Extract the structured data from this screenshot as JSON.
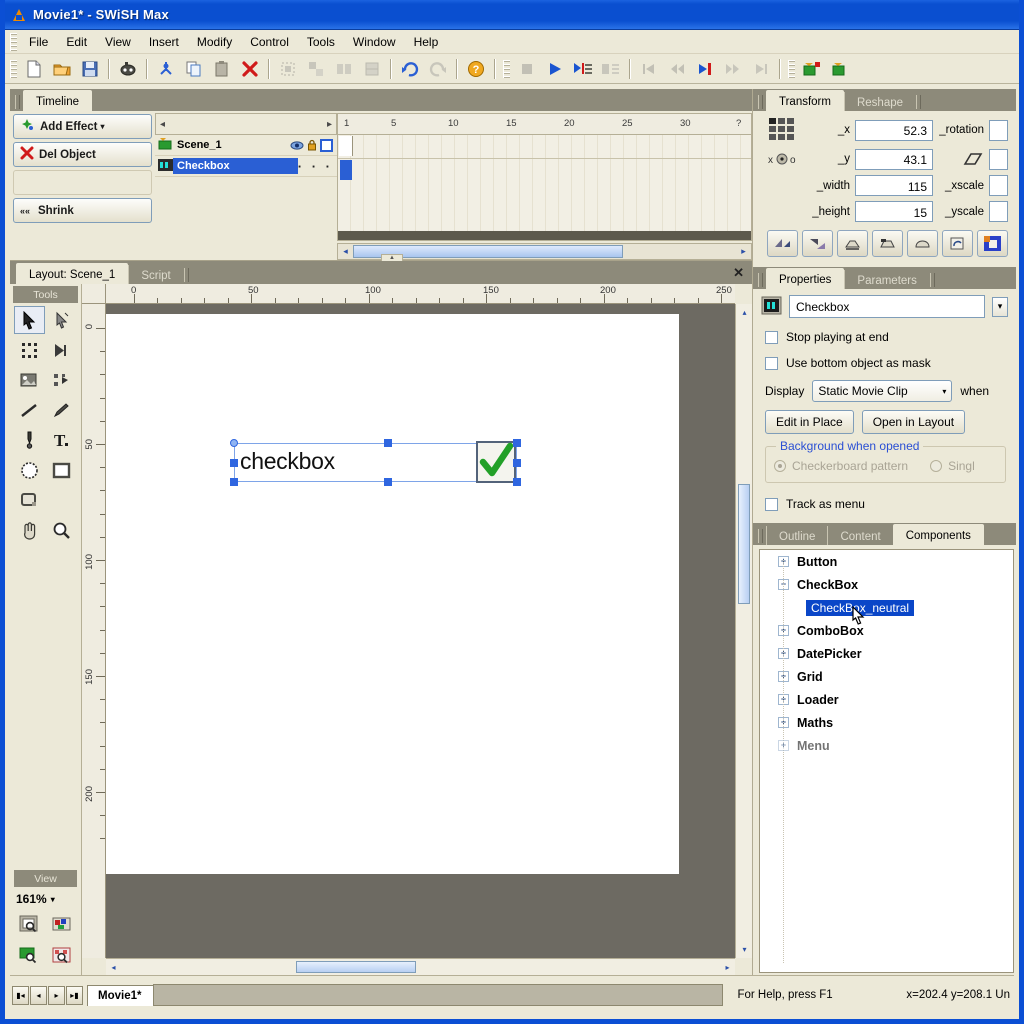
{
  "window": {
    "title": "Movie1* - SWiSH Max",
    "icon": "swish-logo-icon"
  },
  "menubar": {
    "items": [
      {
        "label": "File",
        "accel": "F"
      },
      {
        "label": "Edit",
        "accel": "E"
      },
      {
        "label": "View",
        "accel": "V"
      },
      {
        "label": "Insert",
        "accel": "I"
      },
      {
        "label": "Modify",
        "accel": "M"
      },
      {
        "label": "Control",
        "accel": "C"
      },
      {
        "label": "Tools",
        "accel": "T"
      },
      {
        "label": "Window",
        "accel": "W"
      },
      {
        "label": "Help",
        "accel": "H"
      }
    ]
  },
  "toolbar": {
    "groups": [
      [
        "new-file-icon",
        "open-folder-icon",
        "save-disk-icon"
      ],
      [
        "preview-movie-icon"
      ],
      [
        "cut-icon",
        "copy-icon",
        "paste-icon",
        "delete-icon"
      ],
      [
        "group-icon",
        "ungroup-icon",
        "break-apart-icon",
        "convert-icon"
      ],
      [
        "undo-icon",
        "redo-icon"
      ],
      [
        "help-icon"
      ],
      [
        "stop-icon",
        "play-icon",
        "play-effect-icon",
        "stop-effect-icon"
      ],
      [
        "first-frame-icon",
        "rewind-icon",
        "step-forward-icon",
        "fast-forward-icon",
        "last-frame-icon"
      ],
      [
        "insert-scene-icon",
        "insert-object-icon"
      ]
    ]
  },
  "timeline": {
    "tab": "Timeline",
    "buttons": [
      {
        "label": "Add Effect",
        "icon": "effect-star-icon",
        "caret": "▾"
      },
      {
        "label": "Del Object",
        "icon": "red-x-icon",
        "caret": ""
      },
      {
        "label": "",
        "icon": "",
        "caret": ""
      },
      {
        "label": "Shrink",
        "icon": "shrink-icon",
        "caret": ""
      }
    ],
    "objects": [
      {
        "name": "Scene_1",
        "icon": "scene-icon",
        "selected": false,
        "dots": ""
      },
      {
        "name": "Checkbox",
        "icon": "movieclip-icon",
        "selected": true,
        "dots": "·   ·   ·"
      }
    ],
    "frame_numbers": [
      "1",
      "5",
      "10",
      "15",
      "20",
      "25",
      "30",
      "?"
    ],
    "nav_left": "◂",
    "nav_right": "▸"
  },
  "layout": {
    "tabs": [
      {
        "label": "Layout: Scene_1",
        "active": true
      },
      {
        "label": "Script",
        "active": false
      }
    ],
    "close_label": "✕",
    "tools_header": "Tools",
    "tools": [
      "select-arrow-icon",
      "subselect-arrow-icon",
      "reshape-points-icon",
      "motion-path-icon",
      "fill-transform-icon",
      "free-transform-icon",
      "line-icon",
      "pencil-icon",
      "bezier-pen-icon",
      "text-tool-icon",
      "ellipse-icon",
      "rectangle-icon",
      "autoshape-icon",
      "",
      "hand-tool-icon",
      "zoom-tool-icon"
    ],
    "view_header": "View",
    "zoom_level": "161%",
    "zoom_caret": "▾",
    "view_buttons": [
      "zoom-page-icon",
      "zoom-selection-icon",
      "zoom-scene-icon",
      "zoom-all-icon"
    ],
    "ruler_h": [
      "0",
      "50",
      "100",
      "150",
      "200",
      "250"
    ],
    "ruler_v": [
      "0",
      "50",
      "100",
      "150",
      "200"
    ],
    "stage_object": {
      "label": "checkbox",
      "check_glyph": "✔",
      "check_color": "#22a028"
    }
  },
  "transform": {
    "tabs": [
      {
        "label": "Transform",
        "active": true
      },
      {
        "label": "Reshape",
        "active": false
      }
    ],
    "fields": [
      {
        "label": "_x",
        "value": "52.3"
      },
      {
        "label": "_y",
        "value": "43.1"
      },
      {
        "label": "_width",
        "value": "115"
      },
      {
        "label": "_height",
        "value": "15"
      }
    ],
    "right_fields": [
      {
        "label": "_rotation",
        "value": ""
      },
      {
        "label": "skew-icon",
        "value": ""
      },
      {
        "label": "_xscale",
        "value": ""
      },
      {
        "label": "_yscale",
        "value": ""
      }
    ],
    "anchor_icon": "anchor-grid-icon",
    "center_icon": "center-point-icon",
    "action_buttons": [
      "flip-horizontal-icon",
      "flip-vertical-icon",
      "align-left-icon",
      "align-center-icon",
      "align-right-icon",
      "rotate-icon",
      "color-swatch-icon"
    ]
  },
  "properties": {
    "tabs": [
      {
        "label": "Properties",
        "active": true
      },
      {
        "label": "Parameters",
        "active": false
      }
    ],
    "name_icon": "movieclip-icon",
    "name_value": "Checkbox",
    "checkboxes": [
      {
        "label": "Stop playing at end",
        "checked": false
      },
      {
        "label": "Use bottom object as mask",
        "checked": false
      }
    ],
    "display_label": "Display",
    "display_value": "Static Movie Clip",
    "display_caret": "▾",
    "when_label": "when",
    "buttons": [
      "Edit in Place",
      "Open in Layout"
    ],
    "group_title": "Background when opened",
    "radios": [
      {
        "label": "Checkerboard pattern",
        "selected": true
      },
      {
        "label": "Singl",
        "selected": false
      }
    ],
    "track_as_menu": {
      "label": "Track as menu",
      "checked": false
    }
  },
  "components": {
    "tabs": [
      {
        "label": "Outline",
        "active": false
      },
      {
        "label": "Content",
        "active": false
      },
      {
        "label": "Components",
        "active": true
      }
    ],
    "tree": [
      {
        "label": "Button",
        "expander": "+",
        "level": 0,
        "selected": false
      },
      {
        "label": "CheckBox",
        "expander": "−",
        "level": 0,
        "selected": false
      },
      {
        "label": "CheckBox_neutral",
        "expander": "",
        "level": 1,
        "selected": true
      },
      {
        "label": "ComboBox",
        "expander": "+",
        "level": 0,
        "selected": false
      },
      {
        "label": "DatePicker",
        "expander": "+",
        "level": 0,
        "selected": false
      },
      {
        "label": "Grid",
        "expander": "+",
        "level": 0,
        "selected": false
      },
      {
        "label": "Loader",
        "expander": "+",
        "level": 0,
        "selected": false
      },
      {
        "label": "Maths",
        "expander": "+",
        "level": 0,
        "selected": false
      },
      {
        "label": "Menu",
        "expander": "+",
        "level": 0,
        "selected": false
      }
    ]
  },
  "statusbar": {
    "nav_buttons": [
      "⏮",
      "◀",
      "▶",
      "⏭"
    ],
    "scene_tab": "Movie1*",
    "help_text": "For Help, press F1",
    "coords_text": "x=202.4 y=208.1 Un"
  },
  "colors": {
    "title_blue": "#0a4fd0",
    "panel_bg": "#ece9d8",
    "selection_blue": "#2a5fd4",
    "tab_inactive": "#8d8a7a",
    "check_green": "#22a028"
  }
}
